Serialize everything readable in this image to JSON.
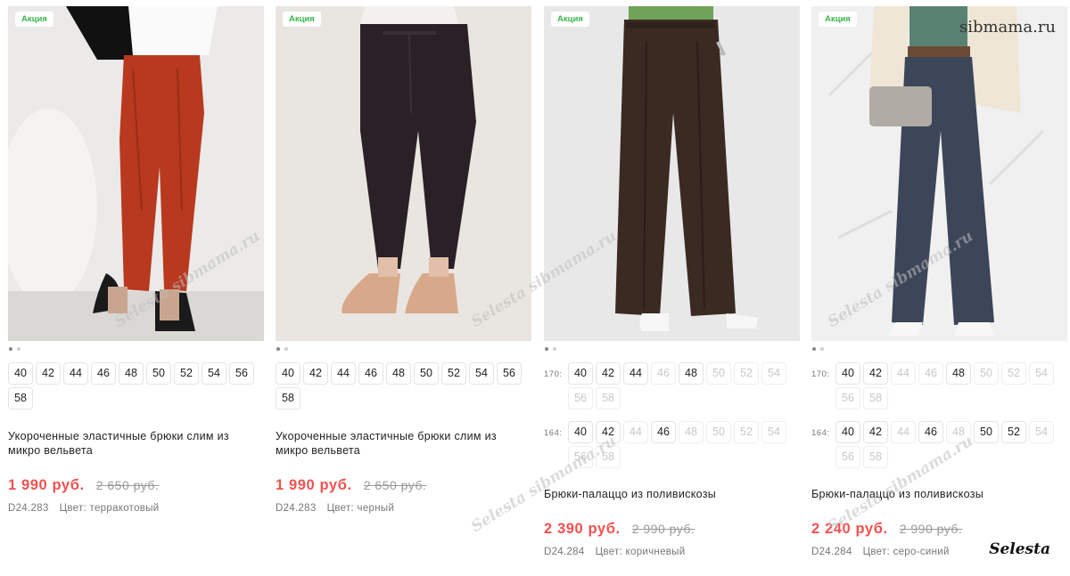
{
  "products": [
    {
      "badge": "Акция",
      "sizes_simple": [
        "40",
        "42",
        "44",
        "46",
        "48",
        "50",
        "52",
        "54",
        "56",
        "58"
      ],
      "title": "Укороченные эластичные брюки слим из микро вельвета",
      "price": "1 990 руб.",
      "old_price": "2 650 руб.",
      "sku": "D24.283",
      "color": "Цвет: терракотовый"
    },
    {
      "badge": "Акция",
      "sizes_simple": [
        "40",
        "42",
        "44",
        "46",
        "48",
        "50",
        "52",
        "54",
        "56",
        "58"
      ],
      "title": "Укороченные эластичные брюки слим из микро вельвета",
      "price": "1 990 руб.",
      "old_price": "2 650 руб.",
      "sku": "D24.283",
      "color": "Цвет: черный"
    },
    {
      "badge": "Акция",
      "height_rows": [
        {
          "height": "170:",
          "sizes": [
            {
              "v": "40",
              "ok": true
            },
            {
              "v": "42",
              "ok": true
            },
            {
              "v": "44",
              "ok": true
            },
            {
              "v": "46",
              "ok": false
            },
            {
              "v": "48",
              "ok": true
            },
            {
              "v": "50",
              "ok": false
            },
            {
              "v": "52",
              "ok": false
            },
            {
              "v": "54",
              "ok": false
            },
            {
              "v": "56",
              "ok": false
            },
            {
              "v": "58",
              "ok": false
            }
          ]
        },
        {
          "height": "164:",
          "sizes": [
            {
              "v": "40",
              "ok": true
            },
            {
              "v": "42",
              "ok": true
            },
            {
              "v": "44",
              "ok": false
            },
            {
              "v": "46",
              "ok": true
            },
            {
              "v": "48",
              "ok": false
            },
            {
              "v": "50",
              "ok": false
            },
            {
              "v": "52",
              "ok": false
            },
            {
              "v": "54",
              "ok": false
            },
            {
              "v": "56",
              "ok": false
            },
            {
              "v": "58",
              "ok": false
            }
          ]
        }
      ],
      "title": "Брюки-палаццо из поливискозы",
      "price": "2 390 руб.",
      "old_price": "2 990 руб.",
      "sku": "D24.284",
      "color": "Цвет: коричневый"
    },
    {
      "badge": "Акция",
      "height_rows": [
        {
          "height": "170:",
          "sizes": [
            {
              "v": "40",
              "ok": true
            },
            {
              "v": "42",
              "ok": true
            },
            {
              "v": "44",
              "ok": false
            },
            {
              "v": "46",
              "ok": false
            },
            {
              "v": "48",
              "ok": true
            },
            {
              "v": "50",
              "ok": false
            },
            {
              "v": "52",
              "ok": false
            },
            {
              "v": "54",
              "ok": false
            },
            {
              "v": "56",
              "ok": false
            },
            {
              "v": "58",
              "ok": false
            }
          ]
        },
        {
          "height": "164:",
          "sizes": [
            {
              "v": "40",
              "ok": true
            },
            {
              "v": "42",
              "ok": true
            },
            {
              "v": "44",
              "ok": false
            },
            {
              "v": "46",
              "ok": true
            },
            {
              "v": "48",
              "ok": false
            },
            {
              "v": "50",
              "ok": true
            },
            {
              "v": "52",
              "ok": true
            },
            {
              "v": "54",
              "ok": false
            },
            {
              "v": "56",
              "ok": false
            },
            {
              "v": "58",
              "ok": false
            }
          ]
        }
      ],
      "title": "Брюки-палаццо из поливискозы",
      "price": "2 240 руб.",
      "old_price": "2 990 руб.",
      "sku": "D24.284",
      "color": "Цвет: серо-синий"
    }
  ],
  "watermarks": {
    "site": "sibmama.ru",
    "signature": "Selesta",
    "overlay": "Selesta sibmama.ru"
  },
  "colors": {
    "promo_green": "#3bb54a",
    "price_red": "#f0524f",
    "trousers": [
      "#b8391f",
      "#2a2126",
      "#3a2a22",
      "#3d4658"
    ]
  }
}
